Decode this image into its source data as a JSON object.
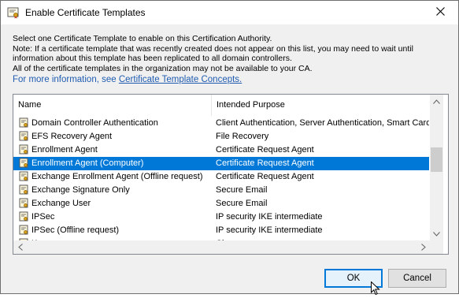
{
  "window": {
    "title": "Enable Certificate Templates",
    "close_glyph": "✕"
  },
  "description": {
    "lines": [
      "Select one Certificate Template to enable on this Certification Authority.",
      "Note: If a certificate template that was recently created does not appear on this list, you may need to wait until",
      "information about this template has been replicated to all domain controllers.",
      "All of the certificate templates in the organization may not be available to your CA."
    ],
    "more_info_prefix": "For more information, see ",
    "more_info_link": "Certificate Template Concepts."
  },
  "list": {
    "columns": {
      "name": "Name",
      "purpose": "Intended Purpose"
    },
    "rows": [
      {
        "name": "Domain Controller Authentication",
        "purpose": "Client Authentication, Server Authentication, Smart Card L",
        "selected": false
      },
      {
        "name": "EFS Recovery Agent",
        "purpose": "File Recovery",
        "selected": false
      },
      {
        "name": "Enrollment Agent",
        "purpose": "Certificate Request Agent",
        "selected": false
      },
      {
        "name": "Enrollment Agent (Computer)",
        "purpose": "Certificate Request Agent",
        "selected": true
      },
      {
        "name": "Exchange Enrollment Agent (Offline request)",
        "purpose": "Certificate Request Agent",
        "selected": false
      },
      {
        "name": "Exchange Signature Only",
        "purpose": "Secure Email",
        "selected": false
      },
      {
        "name": "Exchange User",
        "purpose": "Secure Email",
        "selected": false
      },
      {
        "name": "IPSec",
        "purpose": "IP security IKE intermediate",
        "selected": false
      },
      {
        "name": "IPSec (Offline request)",
        "purpose": "IP security IKE intermediate",
        "selected": false
      },
      {
        "name": "K...",
        "purpose": "Cl...",
        "selected": false
      }
    ],
    "selected_color": "#0078d7"
  },
  "buttons": {
    "ok": "OK",
    "cancel": "Cancel"
  },
  "icons": {
    "title": "certificate-icon",
    "row": "certificate-template-icon"
  }
}
